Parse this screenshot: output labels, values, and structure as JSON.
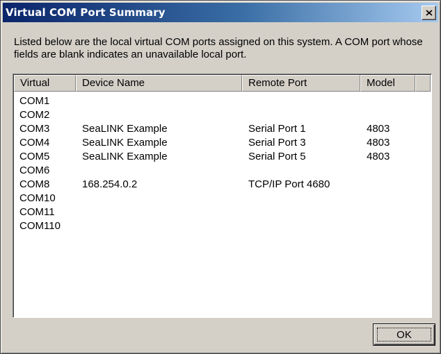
{
  "window": {
    "title": "Virtual COM Port Summary",
    "close_icon": "close-icon"
  },
  "description": "Listed below are the local virtual COM ports assigned on this system.  A COM port whose fields are blank indicates an unavailable local port.",
  "table": {
    "columns": [
      "Virtual",
      "Device Name",
      "Remote Port",
      "Model"
    ],
    "rows": [
      {
        "virtual": "COM1",
        "device": "",
        "remote": "",
        "model": ""
      },
      {
        "virtual": "COM2",
        "device": "",
        "remote": "",
        "model": ""
      },
      {
        "virtual": "COM3",
        "device": "SeaLINK Example",
        "remote": "Serial Port 1",
        "model": "4803"
      },
      {
        "virtual": "COM4",
        "device": "SeaLINK Example",
        "remote": "Serial Port 3",
        "model": "4803"
      },
      {
        "virtual": "COM5",
        "device": "SeaLINK Example",
        "remote": "Serial Port 5",
        "model": "4803"
      },
      {
        "virtual": "COM6",
        "device": "",
        "remote": "",
        "model": ""
      },
      {
        "virtual": "COM8",
        "device": "168.254.0.2",
        "remote": "TCP/IP Port 4680",
        "model": ""
      },
      {
        "virtual": "COM10",
        "device": "",
        "remote": "",
        "model": ""
      },
      {
        "virtual": "COM11",
        "device": "",
        "remote": "",
        "model": ""
      },
      {
        "virtual": "COM110",
        "device": "",
        "remote": "",
        "model": ""
      }
    ]
  },
  "buttons": {
    "ok_label": "OK"
  },
  "colors": {
    "title_gradient_start": "#0a246a",
    "title_gradient_end": "#a6caf0",
    "dialog_face": "#d4d0c8",
    "list_background": "#ffffff"
  }
}
